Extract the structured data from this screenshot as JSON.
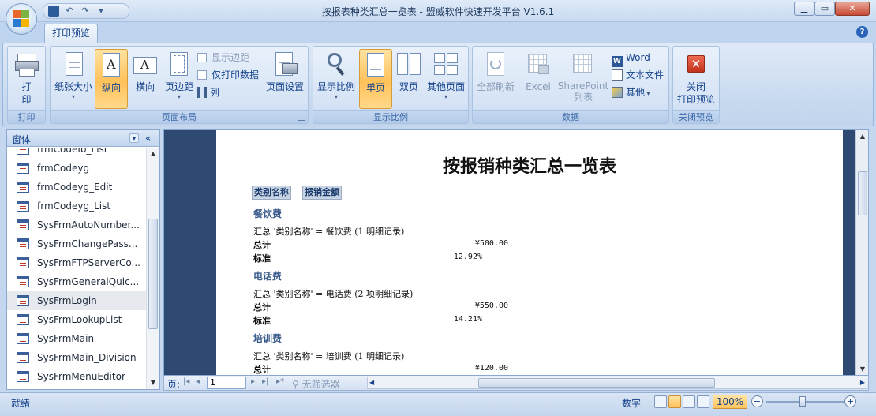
{
  "window": {
    "title": "按报表种类汇总一览表 - 盟威软件快速开发平台 V1.6.1"
  },
  "qat": {
    "undo_icon": "↶",
    "redo_icon": "↷",
    "menu_icon": "▾"
  },
  "ribbon": {
    "tab_label": "打印预览",
    "help": "?",
    "groups": {
      "print": {
        "label": "打印",
        "print_button": "打\n印"
      },
      "layout": {
        "label": "页面布局",
        "paper_size": "纸张大小",
        "portrait": "纵向",
        "landscape": "横向",
        "margins": "页边距",
        "show_margins": "显示边距",
        "print_data_only": "仅打印数据",
        "columns": "列",
        "page_setup": "页面设置"
      },
      "zoom": {
        "label": "显示比例",
        "zoom_button": "显示比例",
        "one_page": "单页",
        "two_pages": "双页",
        "more_pages": "其他页面"
      },
      "data": {
        "label": "数据",
        "refresh_all": "全部刷新",
        "excel": "Excel",
        "sharepoint": "SharePoint",
        "sharepoint_sub": "列表",
        "word": "Word",
        "text_file": "文本文件",
        "more": "其他"
      },
      "close": {
        "label": "关闭预览",
        "close_line1": "关闭",
        "close_line2": "打印预览"
      }
    }
  },
  "nav": {
    "title": "窗体",
    "drop": "▾",
    "collapse": "«",
    "items": [
      "frmCodeIb_List",
      "frmCodeyg",
      "frmCodeyg_Edit",
      "frmCodeyg_List",
      "SysFrmAutoNumber...",
      "SysFrmChangePass...",
      "SysFrmFTPServerCo...",
      "SysFrmGeneralQuic...",
      "SysFrmLogin",
      "SysFrmLookupList",
      "SysFrmMain",
      "SysFrmMain_Division",
      "SysFrmMenuEditor"
    ],
    "selected_index": 8
  },
  "report": {
    "title": "按报销种类汇总一览表",
    "headers": [
      "类别名称",
      "报销金额"
    ],
    "groups": [
      {
        "name": "餐饮费",
        "summary": "汇总 '类别名称' =  餐饮费 (1 明细记录)",
        "total_label": "总计",
        "total": "¥500.00",
        "std_label": "标准",
        "std": "12.92%"
      },
      {
        "name": "电话费",
        "summary": "汇总 '类别名称' =  电话费 (2 项明细记录)",
        "total_label": "总计",
        "total": "¥550.00",
        "std_label": "标准",
        "std": "14.21%"
      },
      {
        "name": "培训费",
        "summary": "汇总 '类别名称' =  培训费 (1 明细记录)",
        "total_label": "总计",
        "total": "¥120.00"
      }
    ]
  },
  "pager": {
    "label": "页:",
    "page": "1",
    "filter": "无筛选器"
  },
  "status": {
    "ready": "就绪",
    "numlock": "数字",
    "zoom": "100%",
    "zoom_out": "−",
    "zoom_in": "+"
  }
}
